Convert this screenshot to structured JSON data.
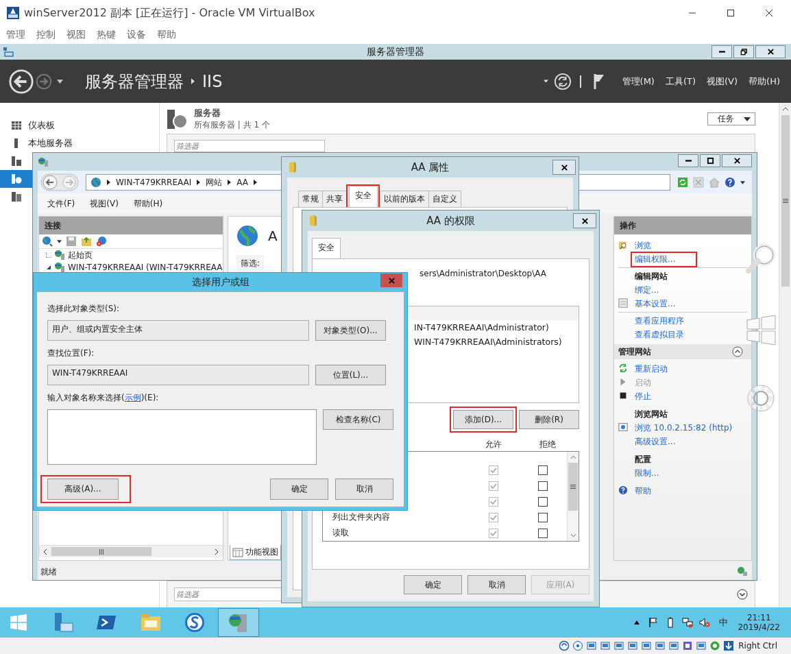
{
  "vbox": {
    "title": "winServer2012 副本 [正在运行] - Oracle VM VirtualBox",
    "menu": [
      "管理",
      "控制",
      "视图",
      "热键",
      "设备",
      "帮助"
    ],
    "hotkey": "Right Ctrl"
  },
  "server_manager": {
    "title": "服务器管理器",
    "breadcrumb": [
      "服务器管理器",
      "IIS"
    ],
    "menu": [
      "管理(M)",
      "工具(T)",
      "视图(V)",
      "帮助(H)"
    ],
    "nav": [
      {
        "label": "仪表板",
        "selected": false
      },
      {
        "label": "本地服务器",
        "selected": false
      },
      {
        "selected": false
      },
      {
        "selected": true
      },
      {
        "selected": false
      }
    ],
    "section": {
      "title": "服务器",
      "subtitle": "所有服务器 | 共 1 个",
      "tasks": "任务",
      "filter_placeholder": "筛选器",
      "filter2_placeholder": "筛选器"
    }
  },
  "iis": {
    "breadcrumb": [
      "WIN-T479KRREAAI",
      "网站",
      "AA"
    ],
    "menu": [
      "文件(F)",
      "视图(V)",
      "帮助(H)"
    ],
    "connections": {
      "title": "连接",
      "tree": [
        {
          "label": "起始页",
          "expanded": false
        },
        {
          "label": "WIN-T479KRREAAI (WIN-T479KRREAA",
          "expanded": true
        }
      ]
    },
    "content": {
      "title": "A",
      "filter": "筛选:",
      "view_tab": "功能视图"
    },
    "actions": {
      "title": "操作",
      "items": [
        {
          "kind": "link",
          "label": "浏览",
          "disabled": false,
          "highlighted": false
        },
        {
          "kind": "link",
          "label": "编辑权限...",
          "disabled": false,
          "highlighted": true
        },
        {
          "kind": "heading",
          "label": "编辑网站"
        },
        {
          "kind": "link",
          "label": "绑定...",
          "disabled": false,
          "highlighted": false
        },
        {
          "kind": "link",
          "label": "基本设置...",
          "disabled": false,
          "highlighted": false
        },
        {
          "kind": "link",
          "label": "查看应用程序",
          "disabled": false,
          "highlighted": false
        },
        {
          "kind": "link",
          "label": "查看虚拟目录",
          "disabled": false,
          "highlighted": false
        },
        {
          "kind": "section",
          "label": "管理网站"
        },
        {
          "kind": "link",
          "label": "重新启动",
          "disabled": false,
          "highlighted": false
        },
        {
          "kind": "link",
          "label": "启动",
          "disabled": true,
          "highlighted": false
        },
        {
          "kind": "link",
          "label": "停止",
          "disabled": false,
          "highlighted": false
        },
        {
          "kind": "heading",
          "label": "浏览网站"
        },
        {
          "kind": "link",
          "label": "浏览 10.0.2.15:82 (http)",
          "disabled": false,
          "highlighted": false
        },
        {
          "kind": "link",
          "label": "高级设置...",
          "disabled": false,
          "highlighted": false
        },
        {
          "kind": "heading",
          "label": "配置"
        },
        {
          "kind": "link",
          "label": "限制...",
          "disabled": false,
          "highlighted": false
        },
        {
          "kind": "link",
          "label": "帮助",
          "disabled": false,
          "highlighted": false
        }
      ]
    },
    "status": "就绪"
  },
  "properties": {
    "title": "AA 属性",
    "tabs": [
      {
        "label": "常规",
        "selected": false,
        "highlighted": false
      },
      {
        "label": "共享",
        "selected": false,
        "highlighted": false
      },
      {
        "label": "安全",
        "selected": true,
        "highlighted": true
      },
      {
        "label": "以前的版本",
        "selected": false,
        "highlighted": false
      },
      {
        "label": "自定义",
        "selected": false,
        "highlighted": false
      }
    ]
  },
  "permissions": {
    "title": "AA 的权限",
    "tab": "安全",
    "object_path": "sers\\Administrator\\Desktop\\AA",
    "users": [
      "IN-T479KRREAAI\\Administrator)",
      "WIN-T479KRREAAI\\Administrators)"
    ],
    "user_buttons": [
      {
        "label": "添加(D)...",
        "highlighted": true
      },
      {
        "label": "删除(R)",
        "highlighted": false
      }
    ],
    "columns": [
      "允许",
      "拒绝"
    ],
    "rows": [
      {
        "allow": true,
        "deny": false,
        "inherited": true
      },
      {
        "allow": true,
        "deny": false,
        "inherited": true
      },
      {
        "allow": true,
        "deny": false,
        "inherited": true
      },
      {
        "label": "列出文件夹内容",
        "allow": true,
        "deny": false,
        "inherited": true
      },
      {
        "label": "读取",
        "allow": true,
        "deny": false,
        "inherited": true
      }
    ],
    "buttons": [
      {
        "label": "确定",
        "disabled": false
      },
      {
        "label": "取消",
        "disabled": false
      },
      {
        "label": "应用(A)",
        "disabled": true
      }
    ]
  },
  "select_dialog": {
    "title": "选择用户或组",
    "type_label": "选择此对象类型(S):",
    "type_value": "用户、组或内置安全主体",
    "type_button": "对象类型(O)...",
    "location_label": "查找位置(F):",
    "location_value": "WIN-T479KRREAAI",
    "location_button": "位置(L)...",
    "names_label": {
      "before": "输入对象名称来选择(",
      "link": "示例",
      "after": ")(E):"
    },
    "check_button": "检查名称(C)",
    "buttons": [
      {
        "label": "高级(A)...",
        "highlighted": true
      },
      {
        "label": "确定",
        "highlighted": false
      },
      {
        "label": "取消",
        "highlighted": false
      }
    ]
  },
  "taskbar": {
    "apps": [
      {
        "selected": false
      },
      {
        "selected": false
      },
      {
        "selected": false
      },
      {
        "selected": false
      },
      {
        "selected": true
      }
    ],
    "ime": "中",
    "time": "21:11",
    "date": "2019/4/22"
  }
}
